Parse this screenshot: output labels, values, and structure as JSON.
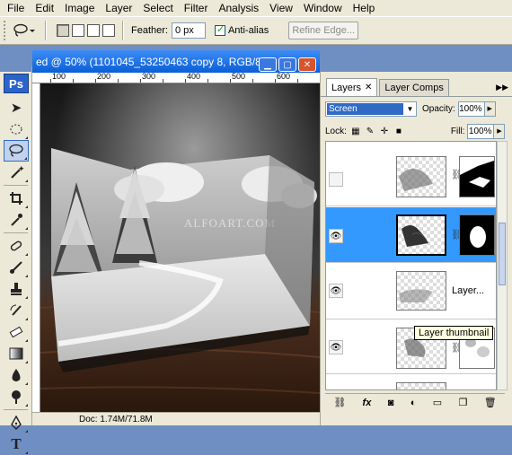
{
  "menu": [
    "File",
    "Edit",
    "Image",
    "Layer",
    "Select",
    "Filter",
    "Analysis",
    "View",
    "Window",
    "Help"
  ],
  "options": {
    "feather_label": "Feather:",
    "feather_value": "0 px",
    "antialias_label": "Anti-alias",
    "refine_label": "Refine Edge..."
  },
  "toolbox": {
    "logo": "Ps"
  },
  "document": {
    "title": "ed @ 50% (1101045_53250463 copy 8, RGB/8)",
    "ruler_ticks": [
      "100",
      "200",
      "300",
      "400",
      "500",
      "600"
    ],
    "watermark": "ALFOART.COM",
    "status": "Doc: 1.74M/71.8M"
  },
  "layers_panel": {
    "tab_layers": "Layers",
    "tab_layer_comps": "Layer Comps",
    "blend_mode": "Screen",
    "opacity_label": "Opacity:",
    "opacity_value": "100%",
    "lock_label": "Lock:",
    "fill_label": "Fill:",
    "fill_value": "100%",
    "layer3_name": "Layer...",
    "tooltip": "Layer thumbnail"
  }
}
